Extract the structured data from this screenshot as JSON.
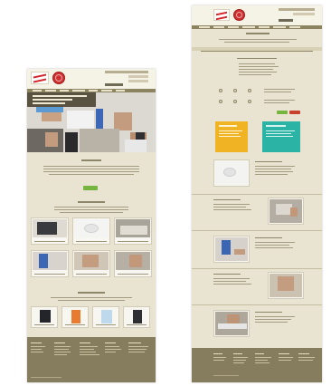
{
  "screens": [
    {
      "hero": {
        "tagline": "",
        "cta": ""
      },
      "sections": [
        {
          "heading": "",
          "button": ""
        },
        {
          "heading": "",
          "thumbs": [
            "",
            "",
            "",
            "",
            "",
            ""
          ]
        },
        {
          "heading": "",
          "thumbs": [
            "",
            "",
            "",
            ""
          ]
        }
      ]
    },
    {
      "sections": [
        {
          "heading": ""
        },
        {
          "heading": ""
        },
        {
          "heading": ""
        }
      ]
    }
  ],
  "colors": {
    "background": "#e9e4d1",
    "nav": "#8c8461",
    "footer": "#857d5d",
    "accent_green": "#75b43e",
    "accent_red": "#d6252b",
    "teal": "#2bb3a6",
    "yellow": "#efb324"
  },
  "icons": [
    "logo-icon",
    "seal-icon",
    "service-icon"
  ]
}
